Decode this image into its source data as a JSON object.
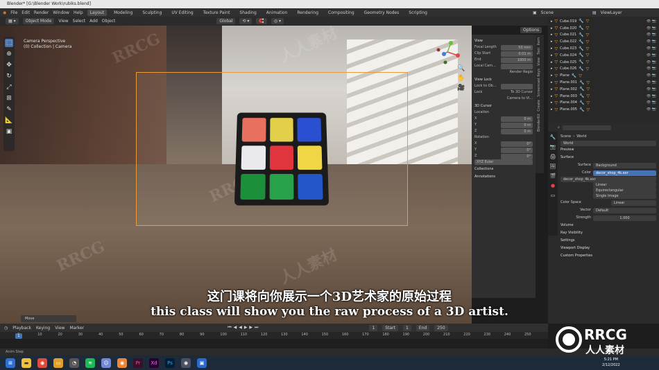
{
  "window": {
    "title": "Blender* [G:\\Blender Work\\rubiks.blend]"
  },
  "menu": {
    "items": [
      "File",
      "Edit",
      "Render",
      "Window",
      "Help"
    ],
    "workspaces": [
      "Layout",
      "Modeling",
      "Sculpting",
      "UV Editing",
      "Texture Paint",
      "Shading",
      "Animation",
      "Rendering",
      "Compositing",
      "Geometry Nodes",
      "Scripting"
    ],
    "active_workspace": "Layout",
    "scene": "Scene",
    "view_layer": "ViewLayer"
  },
  "viewport_header": {
    "mode": "Object Mode",
    "menus": [
      "View",
      "Select",
      "Add",
      "Object"
    ],
    "transform_orientation": "Global",
    "options": "Options"
  },
  "viewport_overlay": {
    "line1": "Camera Perspective",
    "line2": "(0) Collection | Camera"
  },
  "n_panel": {
    "view_title": "View",
    "focal_label": "Focal Length",
    "focal_value": "50 mm",
    "clip_start_label": "Clip Start",
    "clip_start_value": "0.01 m",
    "end_label": "End",
    "end_value": "1000 m",
    "local_camera_label": "Local Cam...",
    "render_region": "Render Regio",
    "view_lock_title": "View Lock",
    "lock_to_object": "Lock to Ob...",
    "lock_label": "Lock",
    "to_3d_cursor": "To 3D Cursor",
    "camera_to_view": "Camera to Vi...",
    "cursor_title": "3D Cursor",
    "location_label": "Location",
    "x_label": "X",
    "y_label": "Y",
    "z_label": "Z",
    "loc_x": "0 m",
    "loc_y": "0 m",
    "loc_z": "0 m",
    "rotation_label": "Rotation",
    "rot_x": "0°",
    "rot_y": "0°",
    "rot_z": "0°",
    "rotation_mode": "XYZ Euler",
    "collections": "Collections",
    "annotations": "Annotations",
    "tabs": [
      "Item",
      "Tool",
      "View",
      "Screencast Keys",
      "Create",
      "BlenderKit"
    ]
  },
  "cube_colors": [
    [
      "#e8705e",
      "#e2d04a",
      "#2a4fd0"
    ],
    [
      "#e9e9ee",
      "#e0353c",
      "#f0d544"
    ],
    [
      "#1b8f3a",
      "#28a24a",
      "#2356c8"
    ]
  ],
  "subtitles": {
    "chinese": "这门课将向你展示一个3D艺术家的原始过程",
    "english": "this class will show you the raw process of a 3D artist."
  },
  "move_panel": "Move",
  "outliner": {
    "items": [
      "Cube.019",
      "Cube.020",
      "Cube.021",
      "Cube.022",
      "Cube.023",
      "Cube.024",
      "Cube.025",
      "Cube.026",
      "Plane",
      "Plane.001",
      "Plane.002",
      "Plane.003",
      "Plane.004",
      "Plane.005"
    ]
  },
  "properties": {
    "scene_label": "Scene",
    "world_label": "World",
    "world_name": "World",
    "preview": "Preview",
    "surface_section": "Surface",
    "surface_label": "Surface",
    "surface_value": "Background",
    "color_label": "Color",
    "color_value": "decor_shop_4k.exr",
    "image_name": "decor_shop_4k.exr",
    "interp": "Linear",
    "projection": "Equirectangular",
    "source": "Single Image",
    "color_space_label": "Color Space",
    "color_space_value": "Linear",
    "vector_label": "Vector",
    "vector_value": "Default",
    "strength_label": "Strength",
    "strength_value": "1.000",
    "volume": "Volume",
    "ray_visibility": "Ray Visibility",
    "settings": "Settings",
    "viewport_display": "Viewport Display",
    "custom_properties": "Custom Properties"
  },
  "timeline": {
    "menus": [
      "Playback",
      "Keying",
      "View",
      "Marker"
    ],
    "current_frame": "1",
    "start_label": "Start",
    "start_value": "1",
    "end_label": "End",
    "end_value": "250",
    "ticks": [
      "0",
      "10",
      "20",
      "30",
      "40",
      "50",
      "60",
      "70",
      "80",
      "90",
      "100",
      "110",
      "120",
      "130",
      "140",
      "150",
      "160",
      "170",
      "180",
      "190",
      "200",
      "210",
      "220",
      "230",
      "240",
      "250"
    ]
  },
  "status_bar": {
    "text": "Anim Step"
  },
  "taskbar": {
    "time": "5:21 PM",
    "date": "2/12/2022"
  },
  "watermark": {
    "brand": "RRCG",
    "brand_cn": "人人素材"
  }
}
